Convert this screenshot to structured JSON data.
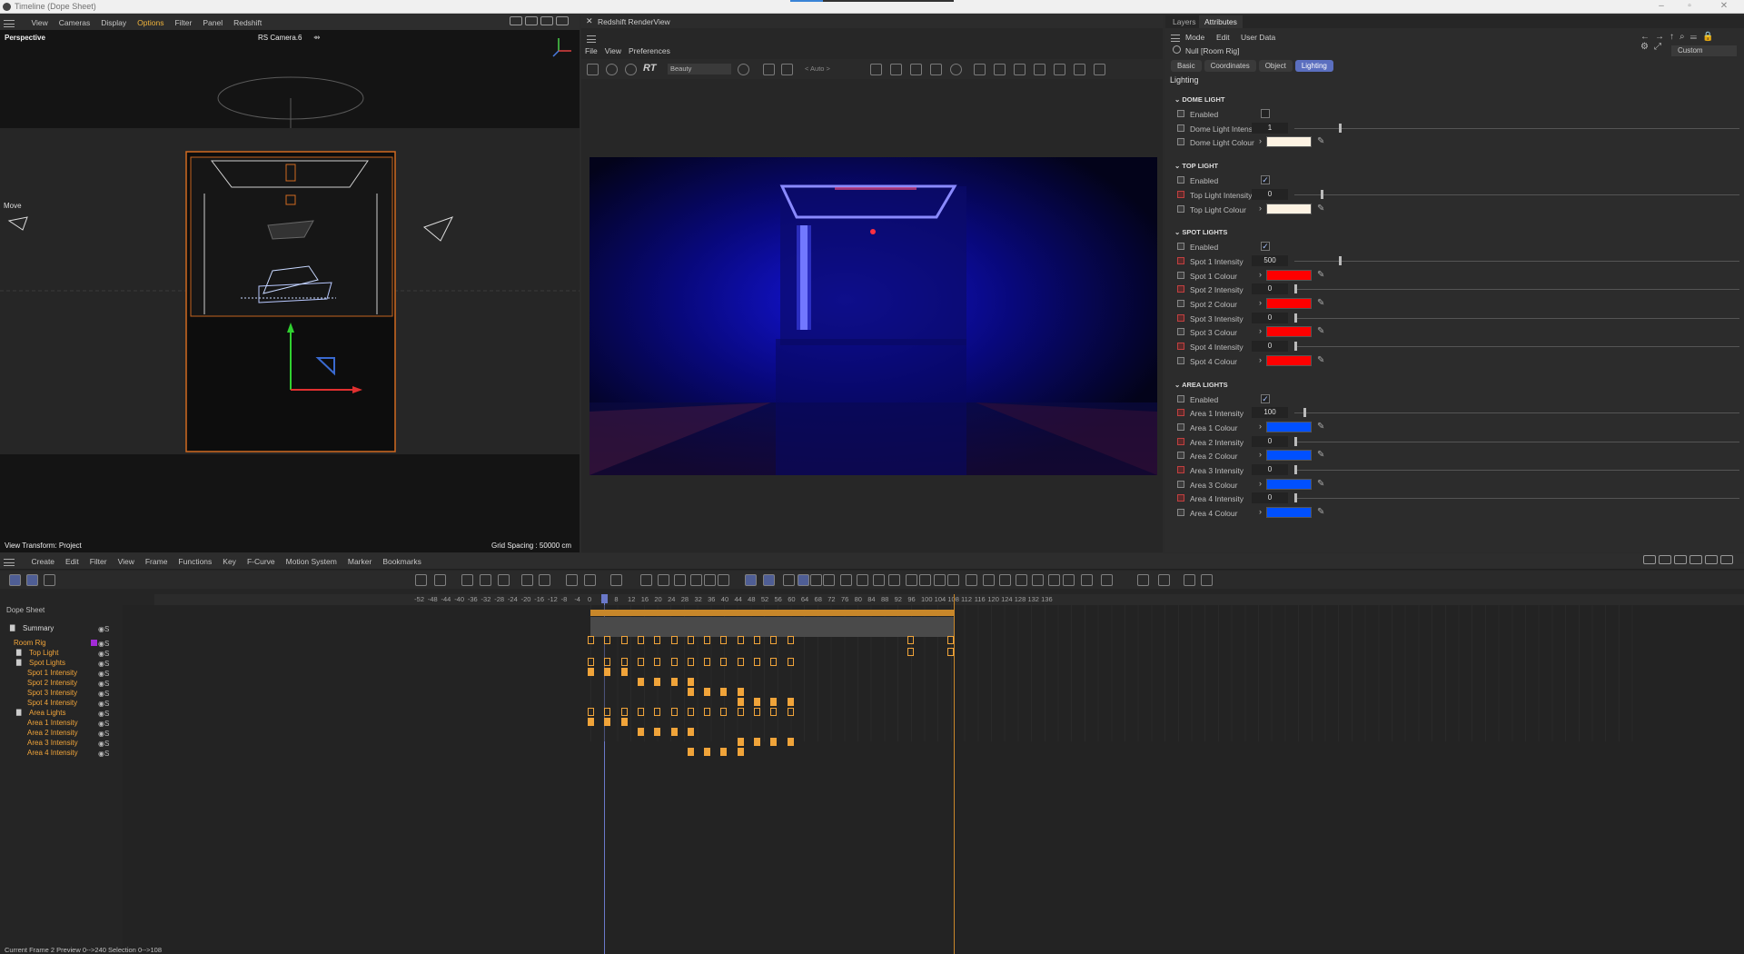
{
  "window": {
    "title": "Timeline (Dope Sheet)"
  },
  "viewport": {
    "menu": [
      "View",
      "Cameras",
      "Display",
      "Options",
      "Filter",
      "Panel",
      "Redshift"
    ],
    "active_menu": "Options",
    "label": "Perspective",
    "camera": "RS Camera.6",
    "tool": "Move",
    "view_transform": "View Transform: Project",
    "grid_spacing": "Grid Spacing : 50000 cm"
  },
  "renderview": {
    "title": "Redshift RenderView",
    "menu": [
      "File",
      "View",
      "Preferences"
    ],
    "rt_label": "RT",
    "aov": "Beauty",
    "auto": "< Auto >"
  },
  "attributes": {
    "tabs": [
      "Layers",
      "Attributes"
    ],
    "active_tab": "Attributes",
    "menu": [
      "Mode",
      "Edit",
      "User Data"
    ],
    "object": "Null [Room Rig]",
    "preset": "Custom",
    "subtabs": [
      "Basic",
      "Coordinates",
      "Object",
      "Lighting"
    ],
    "active_subtab": "Lighting",
    "group": "Lighting",
    "sections": [
      {
        "title": "DOME LIGHT",
        "props": [
          {
            "label": "Enabled",
            "type": "check",
            "checked": false
          },
          {
            "label": "Dome Light Intensity",
            "type": "num",
            "value": "1",
            "level": 0.1
          },
          {
            "label": "Dome Light Colour",
            "type": "color",
            "color": "#fdf3e3"
          }
        ]
      },
      {
        "title": "TOP LIGHT",
        "props": [
          {
            "label": "Enabled",
            "type": "check",
            "checked": true
          },
          {
            "label": "Top Light Intensity",
            "type": "num",
            "value": "0",
            "level": 0.06
          },
          {
            "label": "Top Light Colour",
            "type": "color",
            "color": "#fdf3e3"
          }
        ]
      },
      {
        "title": "SPOT LIGHTS",
        "props": [
          {
            "label": "Enabled",
            "type": "check",
            "checked": true
          },
          {
            "label": "Spot 1 Intensity",
            "type": "num",
            "value": "500",
            "level": 0.1
          },
          {
            "label": "Spot 1 Colour",
            "type": "color",
            "color": "#ff0000"
          },
          {
            "label": "Spot 2 Intensity",
            "type": "num",
            "value": "0",
            "level": 0
          },
          {
            "label": "Spot 2 Colour",
            "type": "color",
            "color": "#ff0000"
          },
          {
            "label": "Spot 3 Intensity",
            "type": "num",
            "value": "0",
            "level": 0
          },
          {
            "label": "Spot 3 Colour",
            "type": "color",
            "color": "#ff0000"
          },
          {
            "label": "Spot 4 Intensity",
            "type": "num",
            "value": "0",
            "level": 0
          },
          {
            "label": "Spot 4 Colour",
            "type": "color",
            "color": "#ff0000"
          }
        ]
      },
      {
        "title": "AREA LIGHTS",
        "props": [
          {
            "label": "Enabled",
            "type": "check",
            "checked": true
          },
          {
            "label": "Area 1 Intensity",
            "type": "num",
            "value": "100",
            "level": 0.02
          },
          {
            "label": "Area 1 Colour",
            "type": "color",
            "color": "#0050ff"
          },
          {
            "label": "Area 2 Intensity",
            "type": "num",
            "value": "0",
            "level": 0
          },
          {
            "label": "Area 2 Colour",
            "type": "color",
            "color": "#0050ff"
          },
          {
            "label": "Area 3 Intensity",
            "type": "num",
            "value": "0",
            "level": 0
          },
          {
            "label": "Area 3 Colour",
            "type": "color",
            "color": "#0050ff"
          },
          {
            "label": "Area 4 Intensity",
            "type": "num",
            "value": "0",
            "level": 0
          },
          {
            "label": "Area 4 Colour",
            "type": "color",
            "color": "#0050ff"
          }
        ]
      }
    ]
  },
  "timeline": {
    "menu": [
      "Create",
      "Edit",
      "Filter",
      "View",
      "Frame",
      "Functions",
      "Key",
      "F-Curve",
      "Motion System",
      "Marker",
      "Bookmarks"
    ],
    "panel_label": "Dope Sheet",
    "ruler_ticks": [
      "-52",
      "-48",
      "-44",
      "-40",
      "-36",
      "-32",
      "-28",
      "-24",
      "-20",
      "-16",
      "-12",
      "-8",
      "-4",
      "0",
      "4",
      "8",
      "12",
      "16",
      "20",
      "24",
      "28",
      "32",
      "36",
      "40",
      "44",
      "48",
      "52",
      "56",
      "60",
      "64",
      "68",
      "72",
      "76",
      "80",
      "84",
      "88",
      "92",
      "96",
      "100",
      "104",
      "108",
      "112",
      "116",
      "120",
      "124",
      "128",
      "132",
      "136"
    ],
    "tree": [
      {
        "name": "Summary",
        "level": 0,
        "kind": "folder"
      },
      {
        "name": "Room Rig",
        "level": 0,
        "kind": "object"
      },
      {
        "name": "Top Light",
        "level": 1,
        "kind": "folder"
      },
      {
        "name": "Spot Lights",
        "level": 1,
        "kind": "folder"
      },
      {
        "name": "Spot 1 Intensity",
        "level": 2,
        "kind": "track"
      },
      {
        "name": "Spot 2 Intensity",
        "level": 2,
        "kind": "track"
      },
      {
        "name": "Spot 3 Intensity",
        "level": 2,
        "kind": "track"
      },
      {
        "name": "Spot 4 Intensity",
        "level": 2,
        "kind": "track"
      },
      {
        "name": "Area Lights",
        "level": 1,
        "kind": "folder"
      },
      {
        "name": "Area 1 Intensity",
        "level": 2,
        "kind": "track"
      },
      {
        "name": "Area 2 Intensity",
        "level": 2,
        "kind": "track"
      },
      {
        "name": "Area 3 Intensity",
        "level": 2,
        "kind": "track"
      },
      {
        "name": "Area 4 Intensity",
        "level": 2,
        "kind": "track"
      }
    ],
    "status": "Current Frame  2   Preview  0-->240    Selection  0-->108"
  }
}
